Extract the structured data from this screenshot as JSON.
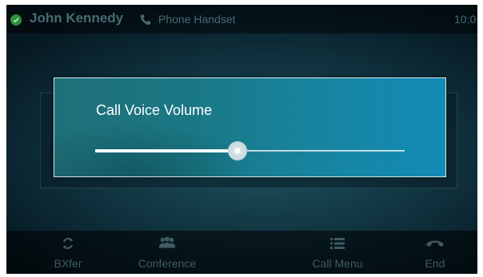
{
  "status_bar": {
    "caller_name": "John Kennedy",
    "device": "Phone Handset",
    "time": "10:0"
  },
  "dialog": {
    "title": "Call Voice Volume",
    "volume_level": 0.46
  },
  "softkeys": [
    {
      "label": "BXfer",
      "icon": "transfer-icon"
    },
    {
      "label": "Conference",
      "icon": "conference-icon"
    },
    {
      "label": "Call Menu",
      "icon": "menu-icon"
    },
    {
      "label": "End",
      "icon": "end-call-icon"
    }
  ],
  "colors": {
    "presence": "#2f8f3c",
    "dialog_accent": "#1785a2",
    "dim_text": "#4a6a73"
  }
}
